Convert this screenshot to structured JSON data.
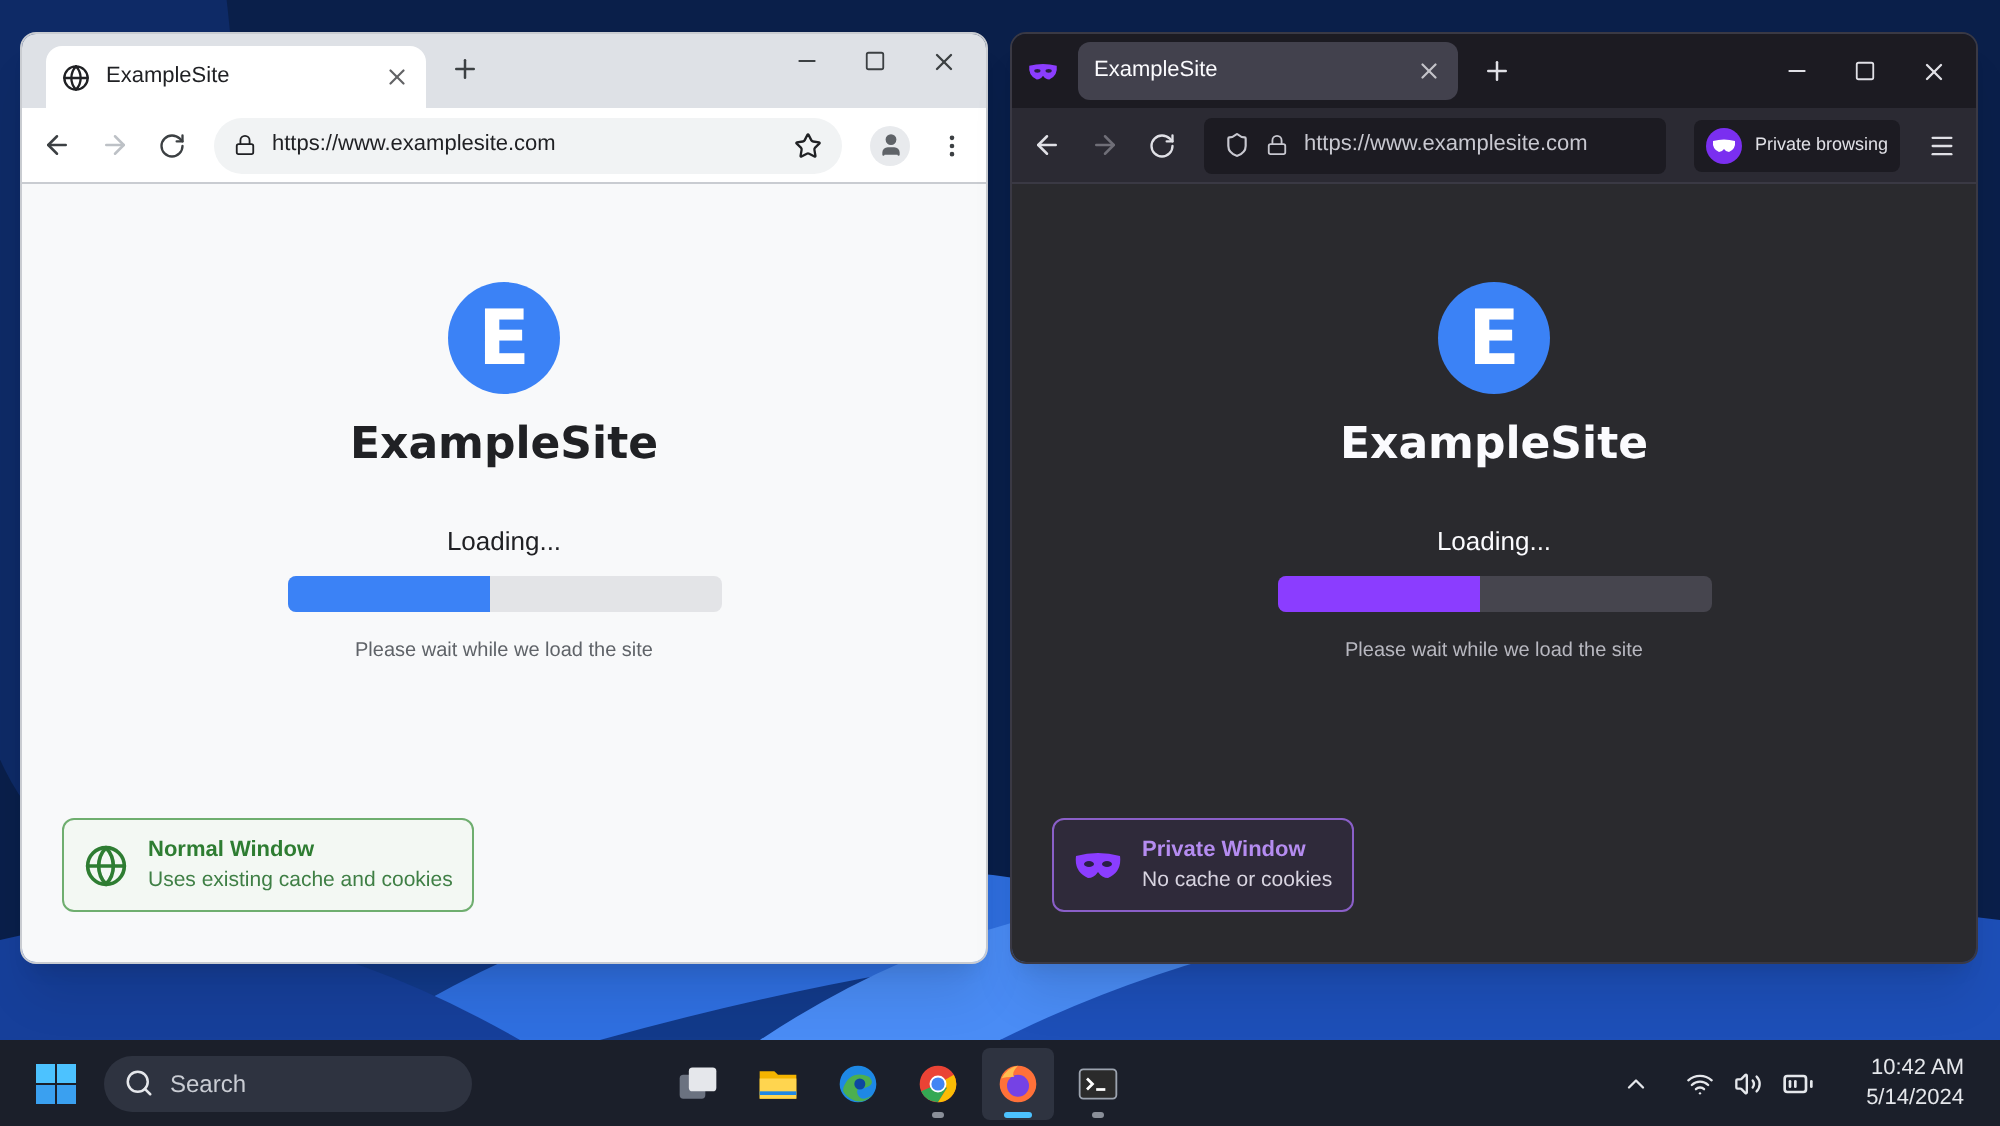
{
  "windows": [
    {
      "kind": "normal",
      "tab": {
        "title": "ExampleSite"
      },
      "url": "https://www.examplesite.com",
      "page": {
        "logo_letter": "E",
        "site_name": "ExampleSite",
        "status": "Loading...",
        "progress": {
          "level": 0.47
        },
        "hint": "Please wait while we load the site"
      },
      "badge": {
        "title": "Normal Window",
        "subtitle": "Uses existing cache and cookies"
      }
    },
    {
      "kind": "private",
      "tab": {
        "title": "ExampleSite"
      },
      "url": "https://www.examplesite.com",
      "private_label": "Private browsing",
      "page": {
        "logo_letter": "E",
        "site_name": "ExampleSite",
        "status": "Loading...",
        "progress": {
          "level": 0.47
        },
        "hint": "Please wait while we load the site"
      },
      "badge": {
        "title": "Private Window",
        "subtitle": "No cache or cookies"
      }
    }
  ],
  "taskbar": {
    "search_placeholder": "Search",
    "apps": [
      {
        "kind": "task-view",
        "selected": false,
        "running": false
      },
      {
        "kind": "folder",
        "selected": false,
        "running": false
      },
      {
        "kind": "edge",
        "selected": false,
        "running": false
      },
      {
        "kind": "chrome",
        "selected": false,
        "running": true
      },
      {
        "kind": "firefox",
        "selected": true,
        "running": true
      },
      {
        "kind": "terminal",
        "selected": false,
        "running": true
      }
    ],
    "time": "10:42 AM",
    "date": "5/14/2024"
  }
}
